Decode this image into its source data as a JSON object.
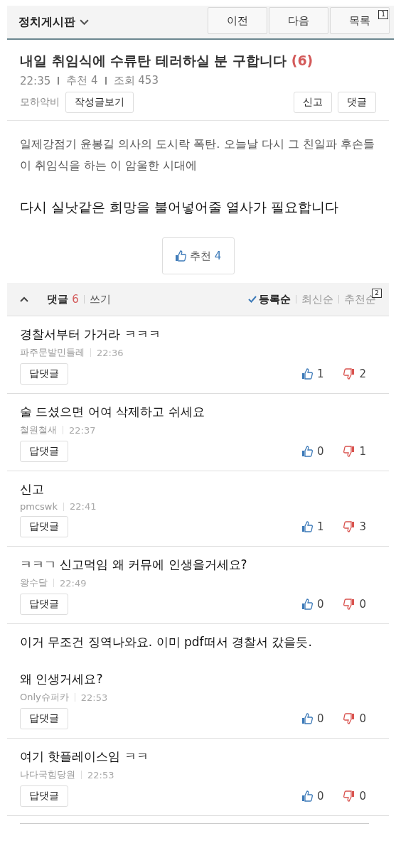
{
  "header": {
    "board": "정치게시판",
    "buttons": [
      "이전",
      "다음",
      "목록"
    ],
    "marker": "1"
  },
  "post": {
    "title": "내일 취임식에 수류탄 테러하실 분 구합니다",
    "comment_count": "(6)",
    "time": "22:35",
    "recommend": "추천 4",
    "views": "조회 453",
    "author": "모하악비",
    "author_button": "작성글보기",
    "actions": [
      "신고",
      "댓글"
    ],
    "paragraphs": [
      {
        "kind": "normal",
        "text": "일제강점기 윤봉길 의사의 도시락 폭탄. 오늘날 다시 그 친일파 후손들이 취임식을 하는 이 암울한 시대에"
      },
      {
        "kind": "large",
        "text": "다시 실낫같은 희망을 불어넣어줄 열사가 필요합니다"
      }
    ],
    "like_label": "추천",
    "like_count": "4"
  },
  "comments_bar": {
    "label": "댓글",
    "count": "6",
    "write": "쓰기",
    "marker": "2",
    "sorts": [
      {
        "label": "등록순",
        "selected": true
      },
      {
        "label": "최신순",
        "selected": false
      },
      {
        "label": "추천순",
        "selected": false
      }
    ]
  },
  "comments": [
    {
      "lines": [
        "경찰서부터 가거라 ㅋㅋㅋ"
      ],
      "author": "파주문발민들레",
      "time": "22:36",
      "reply": "답댓글",
      "up": "1",
      "down": "2"
    },
    {
      "lines": [
        "술 드셨으면 어여 삭제하고 쉬세요"
      ],
      "author": "철원철새",
      "time": "22:37",
      "reply": "답댓글",
      "up": "0",
      "down": "1"
    },
    {
      "lines": [
        "신고"
      ],
      "author": "pmcswk",
      "time": "22:41",
      "reply": "답댓글",
      "up": "1",
      "down": "3"
    },
    {
      "lines": [
        "ㅋㅋㄱ 신고먹임 왜 커뮤에 인생을거세요?"
      ],
      "author": "왕수달",
      "time": "22:49",
      "reply": "답댓글",
      "up": "0",
      "down": "0"
    },
    {
      "lines": [
        "이거 무조건 징역나와요. 이미 pdf떠서 경찰서 갔을듯.",
        "왜 인생거세요?"
      ],
      "author": "Only슈퍼카",
      "time": "22:53",
      "reply": "답댓글",
      "up": "0",
      "down": "0"
    },
    {
      "lines": [
        "여기 핫플레이스임 ㅋㅋ"
      ],
      "author": "나다국힘당원",
      "time": "22:53",
      "reply": "답댓글",
      "up": "0",
      "down": "0"
    }
  ]
}
